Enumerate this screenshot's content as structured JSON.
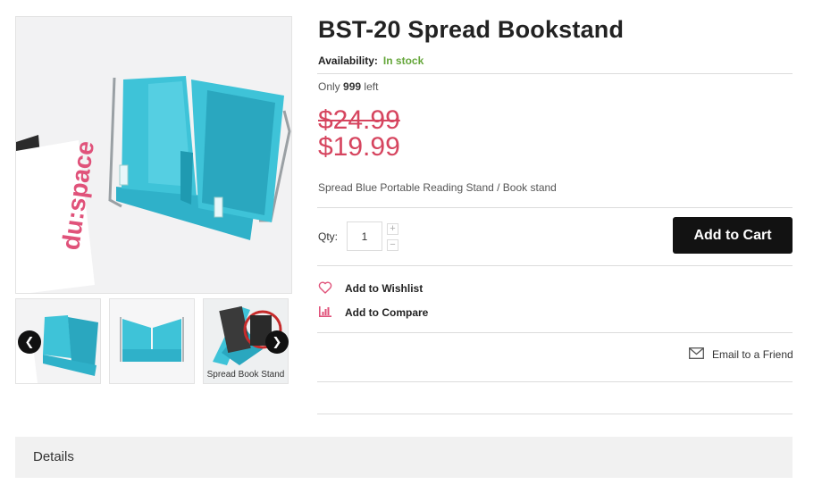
{
  "product": {
    "title": "BST-20 Spread Bookstand",
    "availability_label": "Availability:",
    "availability_value": "In stock",
    "only_prefix": "Only",
    "only_count": "999",
    "only_suffix": "left",
    "old_price": "$24.99",
    "price": "$19.99",
    "short_description": "Spread Blue Portable Reading Stand / Book stand"
  },
  "gallery": {
    "main_logo_text": "du:space",
    "thumb3_caption": "Spread Book Stand",
    "prev_icon": "chevron-left-icon",
    "next_icon": "chevron-right-icon"
  },
  "purchase": {
    "qty_label": "Qty:",
    "qty_value": "1",
    "increase_glyph": "+",
    "decrease_glyph": "−",
    "add_to_cart_label": "Add to Cart"
  },
  "actions": {
    "wishlist_label": "Add to Wishlist",
    "wishlist_icon": "heart-icon",
    "compare_label": "Add to Compare",
    "compare_icon": "bar-chart-icon",
    "email_label": "Email to a Friend",
    "email_icon": "envelope-icon"
  },
  "tabs": {
    "details_label": "Details"
  },
  "colors": {
    "price": "#d6455f",
    "in_stock": "#65a63a",
    "cart_button": "#121212",
    "product_blue": "#3ec3d8",
    "icon_pink": "#e0527a"
  }
}
